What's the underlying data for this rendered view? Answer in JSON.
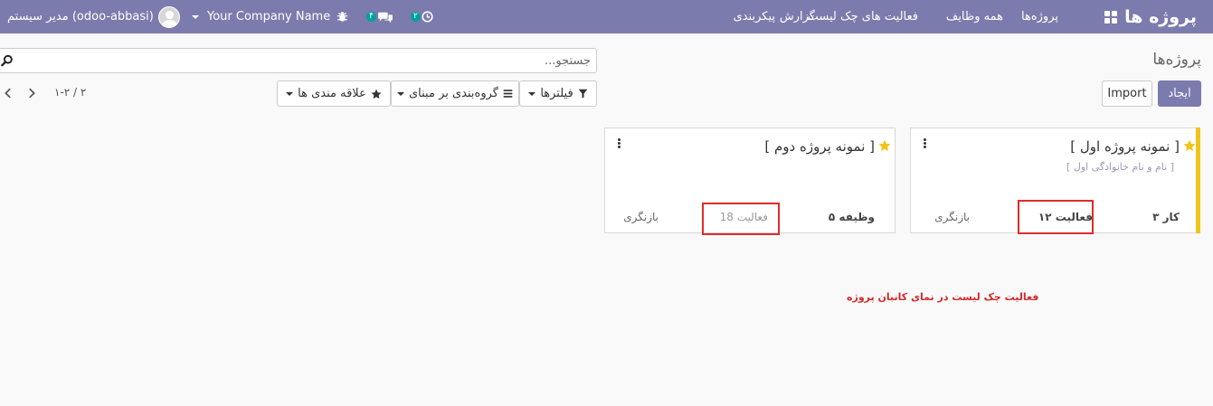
{
  "navbar": {
    "brand": "پروژه ها",
    "menu": [
      "پروژه‌ها",
      "همه وظایف",
      "فعالیت های چک لیست",
      "گزارش",
      "پیکربندی"
    ],
    "activity_count": "۲",
    "messages_count": "۴",
    "company": "Your Company Name",
    "user": "مدیر سیستم (odoo-abbasi)"
  },
  "control_panel": {
    "title": "پروژه‌ها",
    "search_placeholder": "جستجو...",
    "create_label": "ایجاد",
    "import_label": "Import",
    "filters_label": "فیلترها",
    "groupby_label": "گروه‌بندی بر مبنای",
    "favorites_label": "علاقه مندی ها",
    "pager": "۱-۲ / ۲"
  },
  "cards": [
    {
      "title": "[ نمونه پروژه اول ]",
      "subtitle": "[ نام و نام خانوادگی اول ]",
      "tasks": "۳ کار",
      "activity": "۱۲ فعالیت",
      "review": "بازنگری"
    },
    {
      "title": "[ نمونه پروژه دوم ]",
      "tasks": "۵ وظیفه",
      "activity": "فعالیت 18",
      "review": "بازنگری"
    }
  ],
  "annotation": "فعالیت چک لیست در نمای کانبان پروژه",
  "colors": {
    "navbar": "#7c7bad",
    "favorite_star": "#f0c419",
    "highlight": "#e02b2b"
  }
}
